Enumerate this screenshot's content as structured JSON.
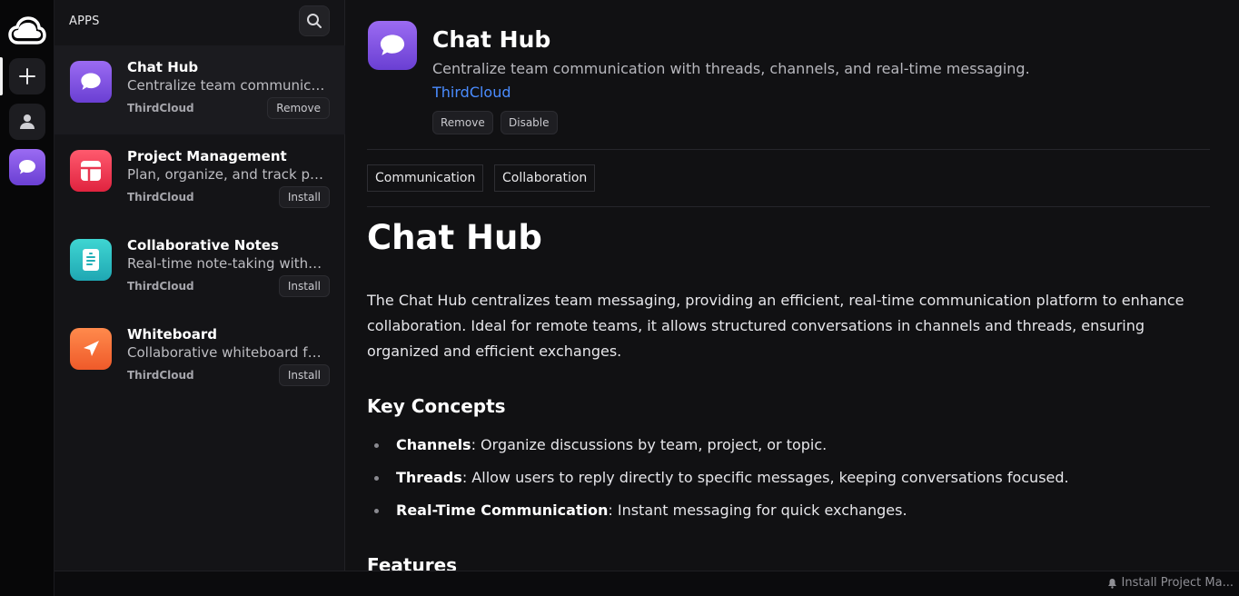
{
  "colors": {
    "accent_link": "#4a8cff",
    "chat_gradient": [
      "#9b6bf2",
      "#6a3fd3"
    ],
    "pm_gradient": [
      "#ff5a6e",
      "#e0233f"
    ],
    "notes_gradient": [
      "#3fd6d2",
      "#1fa7b3"
    ],
    "whiteboard_gradient": [
      "#ff8a4c",
      "#ef5a2a"
    ]
  },
  "rail": {
    "items": [
      {
        "icon": "cloud-logo-icon"
      },
      {
        "icon": "plus-icon"
      },
      {
        "icon": "user-icon"
      },
      {
        "icon": "chat-bubble-icon"
      }
    ]
  },
  "applist": {
    "heading": "APPS",
    "search_icon": "search-icon",
    "items": [
      {
        "name": "Chat Hub",
        "description": "Centralize team communication with threads, channels, and real-time messaging.",
        "vendor": "ThirdCloud",
        "action": "Remove",
        "icon": "chat-bubble-icon",
        "selected": true
      },
      {
        "name": "Project Management",
        "description": "Plan, organize, and track projects",
        "vendor": "ThirdCloud",
        "action": "Install",
        "icon": "grid-icon"
      },
      {
        "name": "Collaborative Notes",
        "description": "Real-time note-taking with your team",
        "vendor": "ThirdCloud",
        "action": "Install",
        "icon": "note-icon"
      },
      {
        "name": "Whiteboard",
        "description": "Collaborative whiteboard for brainstorming",
        "vendor": "ThirdCloud",
        "action": "Install",
        "icon": "paper-plane-icon"
      }
    ]
  },
  "detail": {
    "title": "Chat Hub",
    "description": "Centralize team communication with threads, channels, and real-time messaging.",
    "vendor": "ThirdCloud",
    "buttons": {
      "remove": "Remove",
      "disable": "Disable"
    },
    "tags": [
      "Communication",
      "Collaboration"
    ],
    "doc": {
      "title": "Chat Hub",
      "paragraph": "The Chat Hub centralizes team messaging, providing an efficient, real-time communication platform to enhance collaboration. Ideal for remote teams, it allows structured conversations in channels and threads, ensuring organized and efficient exchanges.",
      "key_concepts_heading": "Key Concepts",
      "key_concepts": [
        {
          "term": "Channels",
          "text": ": Organize discussions by team, project, or topic."
        },
        {
          "term": "Threads",
          "text": ": Allow users to reply directly to specific messages, keeping conversations focused."
        },
        {
          "term": "Real-Time Communication",
          "text": ": Instant messaging for quick exchanges."
        }
      ],
      "features_heading": "Features"
    }
  },
  "statusbar": {
    "notification_text": "Install Project Ma...",
    "icon": "bell-icon"
  }
}
